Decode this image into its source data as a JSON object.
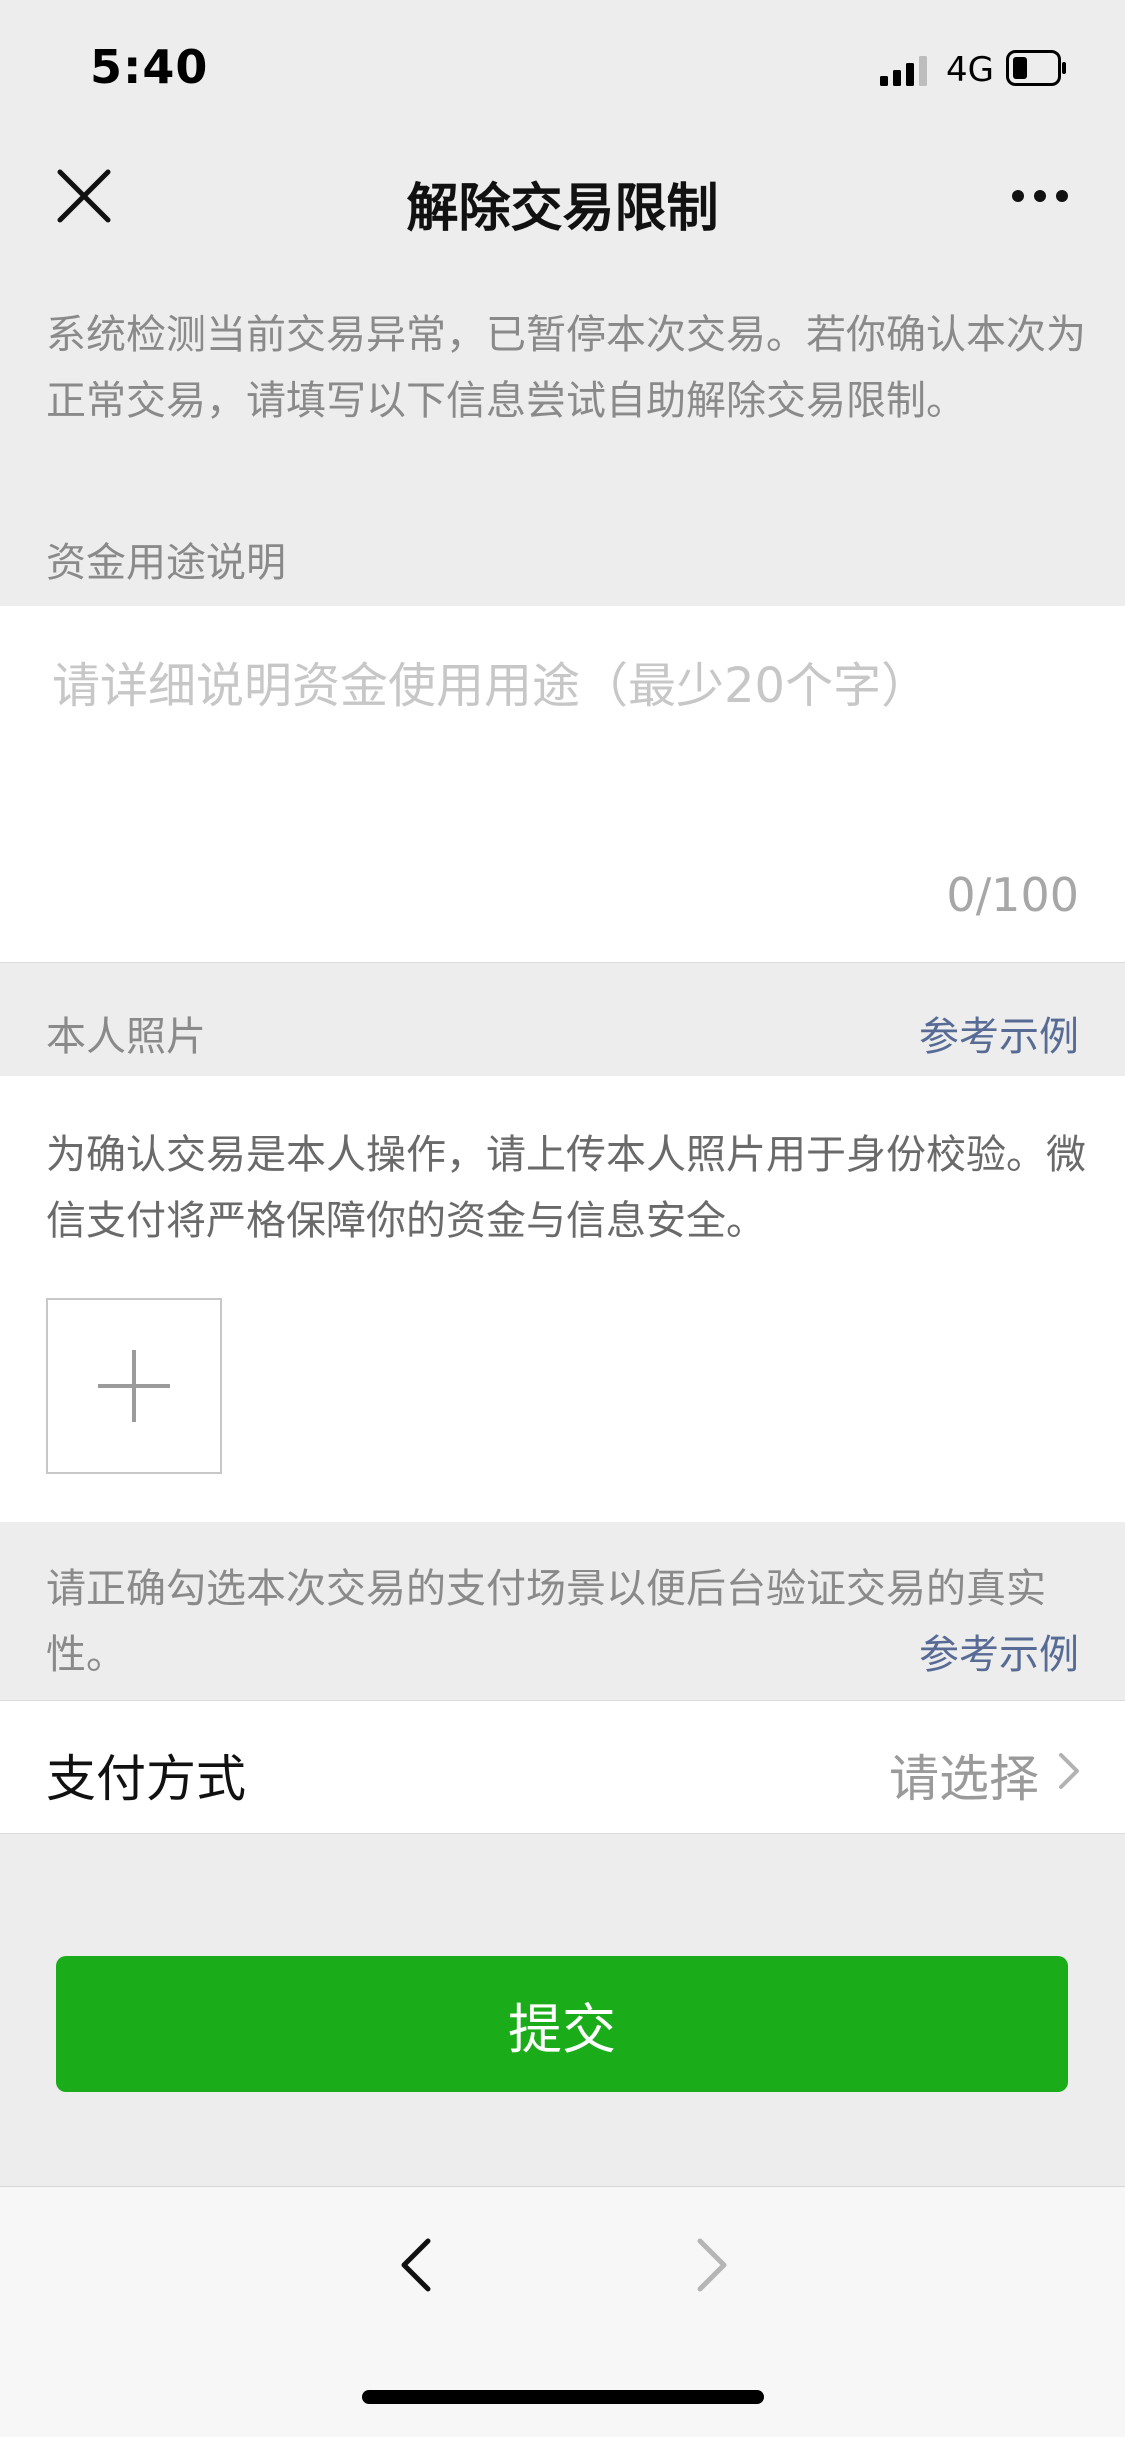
{
  "status_bar": {
    "time": "5:40",
    "network": "4G"
  },
  "nav": {
    "title": "解除交易限制",
    "close_icon": "close-icon",
    "more_icon": "more-icon"
  },
  "intro_text": "系统检测当前交易异常，已暂停本次交易。若你确认本次为正常交易，请填写以下信息尝试自助解除交易限制。",
  "fund_purpose": {
    "label": "资金用途说明",
    "placeholder": "请详细说明资金使用用途（最少20个字）",
    "counter": "0/100"
  },
  "photo": {
    "label": "本人照片",
    "example_link": "参考示例",
    "description": "为确认交易是本人操作，请上传本人照片用于身份校验。微信支付将严格保障你的资金与信息安全。",
    "upload_icon": "plus-icon"
  },
  "scene": {
    "text": "请正确勾选本次交易的支付场景以便后台验证交易的真实性。",
    "example_link": "参考示例"
  },
  "payment_method": {
    "label": "支付方式",
    "value": "请选择"
  },
  "submit_label": "提交",
  "colors": {
    "accent_green": "#1aad19",
    "link_blue": "#576b95",
    "background": "#ededed"
  }
}
